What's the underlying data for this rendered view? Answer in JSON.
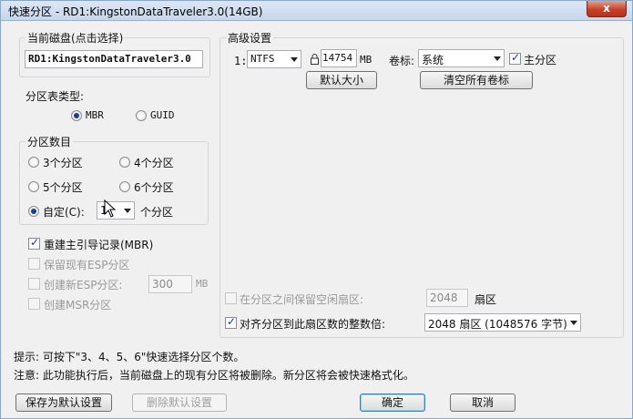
{
  "window": {
    "title": "快速分区 - RD1:KingstonDataTraveler3.0(14GB)",
    "close_label": "x"
  },
  "disk": {
    "group_title": "当前磁盘(点击选择)",
    "value": "RD1:KingstonDataTraveler3.0"
  },
  "partition_table": {
    "label": "分区表类型:",
    "options": [
      "MBR",
      "GUID"
    ],
    "selected": "MBR"
  },
  "partition_count": {
    "group_title": "分区数目",
    "options": [
      "3个分区",
      "4个分区",
      "5个分区",
      "6个分区"
    ],
    "custom_label": "自定(C):",
    "custom_value": "1",
    "custom_suffix": "个分区"
  },
  "options": {
    "rebuild_mbr": "重建主引导记录(MBR)",
    "keep_esp": "保留现有ESP分区",
    "create_esp": "创建新ESP分区:",
    "esp_size": "300",
    "esp_unit": "MB",
    "create_msr": "创建MSR分区"
  },
  "advanced": {
    "group_title": "高级设置",
    "row_index": "1:",
    "filesystem": "NTFS",
    "size": "14754",
    "size_unit": "MB",
    "volume_label_caption": "卷标:",
    "volume_label": "系统",
    "primary_label": "主分区",
    "default_size_button": "默认大小",
    "clear_labels_button": "清空所有卷标",
    "reserve_label": "在分区之间保留空闲扇区:",
    "reserve_value": "2048",
    "reserve_unit": "扇区",
    "align_label": "对齐分区到此扇区数的整数倍:",
    "align_value": "2048 扇区 (1048576 字节)"
  },
  "hints": {
    "tip": "提示: 可按下\"3、4、5、6\"快速选择分区个数。",
    "warning": "注意: 此功能执行后，当前磁盘上的现有分区将被删除。新分区将会被快速格式化。"
  },
  "footer": {
    "save_default": "保存为默认设置",
    "delete_default": "删除默认设置",
    "ok": "确定",
    "cancel": "取消"
  }
}
